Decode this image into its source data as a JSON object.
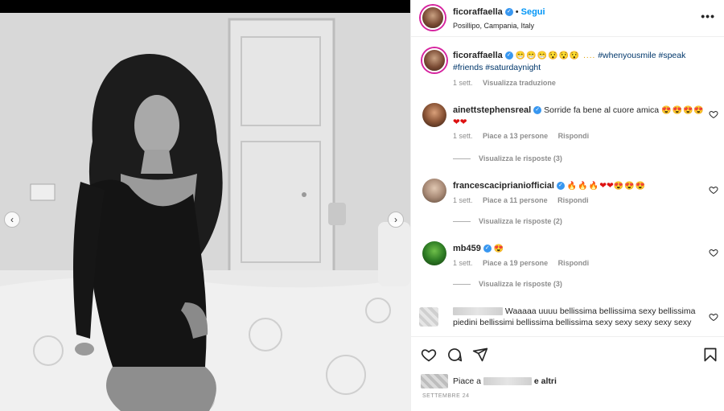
{
  "post": {
    "username": "ficoraffaella",
    "follow_label": "Segui",
    "location": "Posillipo, Campania, Italy",
    "more_label": "•••",
    "caption_emojis": "😁😁😁😯😯😯 ....",
    "caption_tags": [
      "#whenyousmile",
      "#speak",
      "#friends",
      "#saturdaynight"
    ],
    "caption_time": "1 sett.",
    "translate_label": "Visualizza traduzione"
  },
  "comments": [
    {
      "username": "ainettstephensreal",
      "text": "Sorride fa bene al cuore amica",
      "emojis": "😍😍😍😍",
      "hearts": "❤❤",
      "time": "1 sett.",
      "likes": "Piace a 13 persone",
      "reply_label": "Rispondi",
      "replies_label": "Visualizza le risposte (3)"
    },
    {
      "username": "francescacipriani official",
      "username_display": "francescacipri anioffi cial",
      "emojis": "🔥🔥🔥",
      "hearts": "❤❤",
      "emojis2": "😍😍😍",
      "time": "1 sett.",
      "likes": "Piace a 11 persone",
      "reply_label": "Rispondi",
      "replies_label": "Visualizza le risposte (2)"
    },
    {
      "username": "mb459",
      "emojis": "😍",
      "time": "1 sett.",
      "likes": "Piace a 19 persone",
      "reply_label": "Rispondi",
      "replies_label": "Visualizza le risposte (3)"
    },
    {
      "text": "Waaaaa uuuu bellissima bellissima sexy bellissima piedini bellissimi bellissima bellissima sexy sexy sexy sexy sexy"
    }
  ],
  "footer": {
    "likes_prefix": "Piace a",
    "likes_suffix": "e altri",
    "date": "SETTEMBRE 24"
  },
  "colors": {
    "accent": "#0095f6",
    "verified": "#3897f0",
    "muted": "#8e8e8e"
  },
  "icons": [
    "heart-icon",
    "comment-icon",
    "share-icon",
    "bookmark-icon",
    "chevron-left-icon",
    "chevron-right-icon",
    "verified-icon"
  ]
}
